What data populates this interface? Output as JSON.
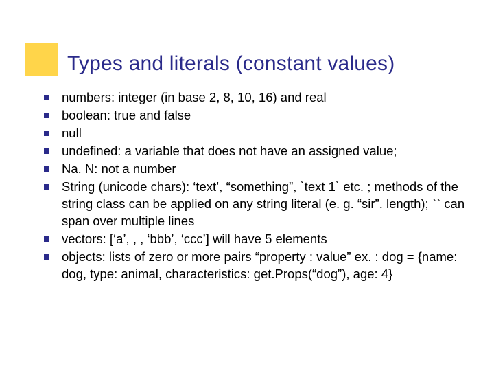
{
  "title": "Types and literals (constant values)",
  "bullets": [
    "numbers: integer (in base 2, 8, 10, 16) and real",
    "boolean: true and false",
    "null",
    "undefined: a variable that does not have an assigned value;",
    "Na. N: not a number",
    "String (unicode chars): ‘text’, “something”, `text 1` etc. ; methods of the string class can be applied on any string literal (e. g. “sir”. length); `` can span over multiple lines",
    "vectors: [‘a’, , , ‘bbb’, ‘ccc’] will have 5 elements",
    "objects: lists of zero or more pairs “property : value” ex. : dog = {name: dog, type: animal, characteristics: get.Props(“dog”), age: 4}"
  ]
}
